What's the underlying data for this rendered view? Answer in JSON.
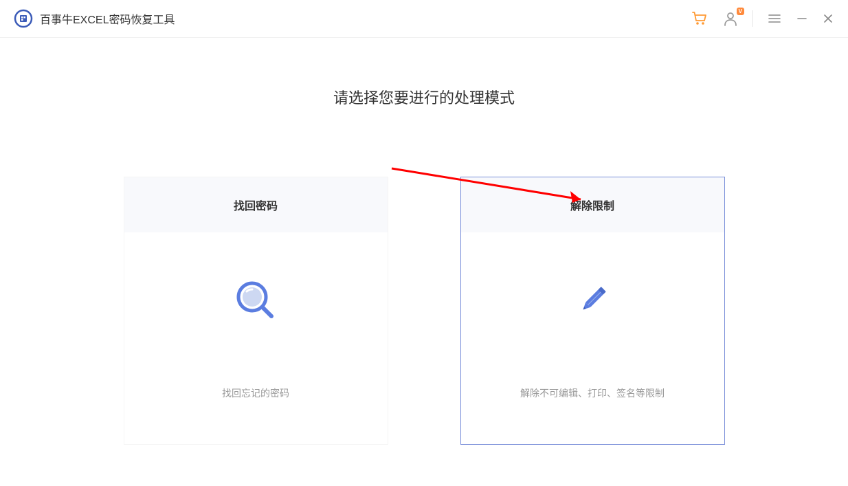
{
  "header": {
    "app_title": "百事牛EXCEL密码恢复工具",
    "vip_badge": "V"
  },
  "main": {
    "title": "请选择您要进行的处理模式"
  },
  "cards": {
    "left": {
      "title": "找回密码",
      "description": "找回忘记的密码"
    },
    "right": {
      "title": "解除限制",
      "description": "解除不可编辑、打印、签名等限制"
    }
  }
}
